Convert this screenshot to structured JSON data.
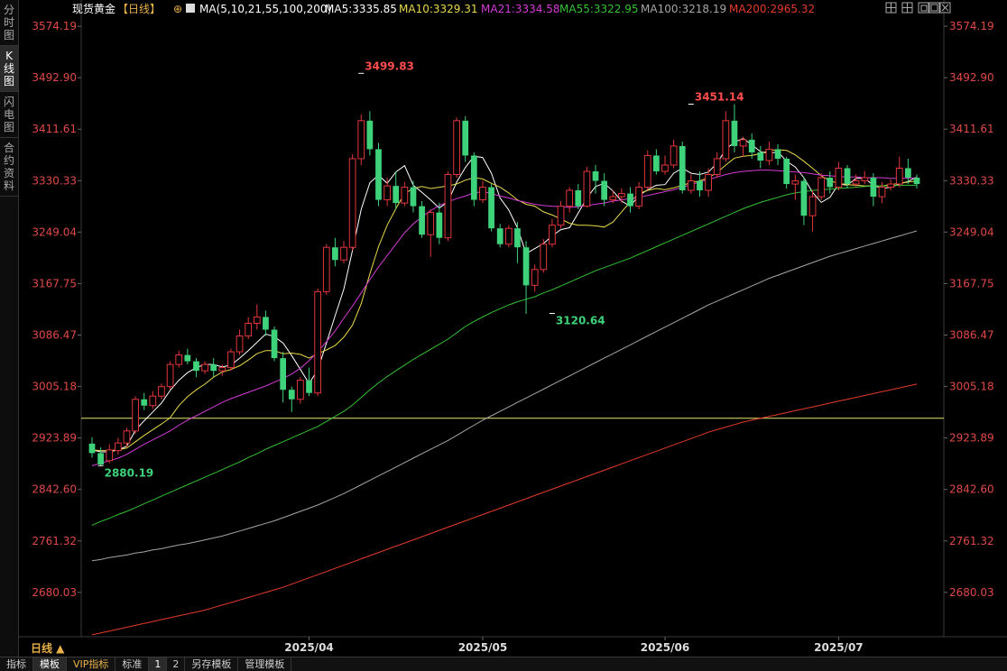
{
  "sidebar": {
    "tabs": [
      {
        "label": "分\n时\n图",
        "active": false
      },
      {
        "label": "K\n线\n图",
        "active": true
      },
      {
        "label": "闪\n电\n图",
        "active": false
      },
      {
        "label": "合\n约\n资\n料",
        "active": false
      }
    ]
  },
  "header": {
    "instrument": "现货黄金",
    "period": "【日线】",
    "ma_params": "MA(5,10,21,55,100,200)",
    "ma5": "MA5:3335.85",
    "ma10": "MA10:3329.31",
    "ma21": "MA21:3334.58",
    "ma55": "MA55:3322.95",
    "ma100": "MA100:3218.19",
    "ma200": "MA200:2965.32",
    "toolbar_icons": [
      "crosshair-icon",
      "grid-icon",
      "restore-icon",
      "maximize-icon",
      "close-icon"
    ]
  },
  "bottom": {
    "period_label": "日线 ▲",
    "items": [
      "指标",
      "模板",
      "VIP指标",
      "标准",
      "1",
      "2",
      "另存模板",
      "管理模板"
    ],
    "active_item": "模板"
  },
  "colors": {
    "up": "#e2363c",
    "down": "#3ed27b",
    "ma5": "#ffffff",
    "ma10": "#e8d94a",
    "ma21": "#d43bd6",
    "ma55": "#34c234",
    "ma100": "#a6a6a6",
    "ma200": "#e53a2b",
    "hline": "#e8e86a",
    "axis_text": "#e04848"
  },
  "chart_data": {
    "type": "candlestick",
    "y_ticks": [
      "3574.19",
      "3492.90",
      "3411.61",
      "3330.33",
      "3249.04",
      "3167.75",
      "3086.47",
      "3005.18",
      "2923.89",
      "2842.60",
      "2761.32",
      "2680.03"
    ],
    "ylim": [
      2610,
      3590
    ],
    "x_ticks": [
      {
        "label": "2025/04",
        "index": 25
      },
      {
        "label": "2025/05",
        "index": 45
      },
      {
        "label": "2025/06",
        "index": 66
      },
      {
        "label": "2025/07",
        "index": 86
      }
    ],
    "annotations": [
      {
        "label": "3499.83",
        "index": 31,
        "value": 3499.83,
        "side": "high",
        "color": "#ff4d4d"
      },
      {
        "label": "3451.14",
        "index": 69,
        "value": 3451.14,
        "side": "high",
        "color": "#ff4d4d"
      },
      {
        "label": "3120.64",
        "index": 53,
        "value": 3120.64,
        "side": "low",
        "color": "#3ed27b"
      },
      {
        "label": "2880.19",
        "index": 1,
        "value": 2880.19,
        "side": "low",
        "color": "#3ed27b"
      }
    ],
    "hline": 2955,
    "candles": [
      [
        2915,
        2900,
        2925,
        2893
      ],
      [
        2900,
        2882,
        2909,
        2880
      ],
      [
        2888,
        2905,
        2914,
        2884
      ],
      [
        2904,
        2916,
        2924,
        2898
      ],
      [
        2916,
        2935,
        2940,
        2910
      ],
      [
        2935,
        2985,
        2990,
        2930
      ],
      [
        2985,
        2975,
        2995,
        2968
      ],
      [
        2975,
        2990,
        2998,
        2970
      ],
      [
        2990,
        3005,
        3010,
        2985
      ],
      [
        3005,
        3040,
        3045,
        3000
      ],
      [
        3040,
        3055,
        3062,
        3035
      ],
      [
        3055,
        3045,
        3065,
        3040
      ],
      [
        3045,
        3030,
        3050,
        3020
      ],
      [
        3030,
        3040,
        3045,
        3025
      ],
      [
        3040,
        3030,
        3050,
        3020
      ],
      [
        3030,
        3035,
        3040,
        3022
      ],
      [
        3035,
        3060,
        3065,
        3030
      ],
      [
        3060,
        3085,
        3095,
        3055
      ],
      [
        3085,
        3105,
        3115,
        3080
      ],
      [
        3105,
        3115,
        3135,
        3095
      ],
      [
        3115,
        3095,
        3125,
        3085
      ],
      [
        3095,
        3050,
        3100,
        3045
      ],
      [
        3050,
        3000,
        3060,
        2980
      ],
      [
        3000,
        2985,
        3005,
        2965
      ],
      [
        2985,
        3015,
        3020,
        2978
      ],
      [
        3015,
        2995,
        3035,
        2990
      ],
      [
        2995,
        3155,
        3160,
        2990
      ],
      [
        3155,
        3225,
        3230,
        3150
      ],
      [
        3225,
        3205,
        3240,
        3195
      ],
      [
        3205,
        3225,
        3235,
        3200
      ],
      [
        3225,
        3365,
        3372,
        3220
      ],
      [
        3365,
        3425,
        3435,
        3355
      ],
      [
        3425,
        3380,
        3440,
        3370
      ],
      [
        3380,
        3300,
        3390,
        3290
      ],
      [
        3300,
        3322,
        3335,
        3290
      ],
      [
        3322,
        3295,
        3345,
        3285
      ],
      [
        3295,
        3320,
        3328,
        3290
      ],
      [
        3320,
        3290,
        3330,
        3280
      ],
      [
        3290,
        3245,
        3298,
        3240
      ],
      [
        3245,
        3280,
        3285,
        3210
      ],
      [
        3280,
        3240,
        3295,
        3230
      ],
      [
        3240,
        3340,
        3345,
        3235
      ],
      [
        3340,
        3425,
        3430,
        3335
      ],
      [
        3425,
        3370,
        3432,
        3360
      ],
      [
        3370,
        3300,
        3375,
        3290
      ],
      [
        3300,
        3320,
        3330,
        3295
      ],
      [
        3320,
        3255,
        3325,
        3250
      ],
      [
        3255,
        3230,
        3262,
        3225
      ],
      [
        3230,
        3255,
        3260,
        3225
      ],
      [
        3255,
        3225,
        3265,
        3200
      ],
      [
        3225,
        3165,
        3235,
        3120
      ],
      [
        3165,
        3190,
        3198,
        3155
      ],
      [
        3190,
        3230,
        3238,
        3185
      ],
      [
        3230,
        3260,
        3270,
        3225
      ],
      [
        3260,
        3290,
        3298,
        3255
      ],
      [
        3290,
        3315,
        3320,
        3280
      ],
      [
        3315,
        3290,
        3325,
        3285
      ],
      [
        3290,
        3345,
        3352,
        3288
      ],
      [
        3345,
        3330,
        3355,
        3310
      ],
      [
        3330,
        3300,
        3342,
        3290
      ],
      [
        3300,
        3305,
        3315,
        3295
      ],
      [
        3305,
        3310,
        3318,
        3295
      ],
      [
        3310,
        3290,
        3320,
        3280
      ],
      [
        3290,
        3320,
        3328,
        3285
      ],
      [
        3320,
        3370,
        3378,
        3315
      ],
      [
        3370,
        3345,
        3380,
        3340
      ],
      [
        3345,
        3355,
        3370,
        3340
      ],
      [
        3355,
        3385,
        3395,
        3350
      ],
      [
        3385,
        3315,
        3392,
        3310
      ],
      [
        3315,
        3330,
        3340,
        3310
      ],
      [
        3330,
        3315,
        3345,
        3305
      ],
      [
        3315,
        3340,
        3350,
        3305
      ],
      [
        3340,
        3365,
        3375,
        3335
      ],
      [
        3365,
        3425,
        3440,
        3360
      ],
      [
        3425,
        3385,
        3451,
        3375
      ],
      [
        3385,
        3395,
        3400,
        3368
      ],
      [
        3395,
        3375,
        3405,
        3365
      ],
      [
        3375,
        3362,
        3385,
        3350
      ],
      [
        3362,
        3380,
        3392,
        3355
      ],
      [
        3380,
        3365,
        3388,
        3355
      ],
      [
        3365,
        3325,
        3368,
        3318
      ],
      [
        3325,
        3330,
        3340,
        3300
      ],
      [
        3330,
        3275,
        3336,
        3260
      ],
      [
        3275,
        3305,
        3315,
        3250
      ],
      [
        3305,
        3335,
        3342,
        3300
      ],
      [
        3335,
        3320,
        3345,
        3310
      ],
      [
        3320,
        3350,
        3360,
        3315
      ],
      [
        3350,
        3325,
        3355,
        3318
      ],
      [
        3325,
        3330,
        3340,
        3320
      ],
      [
        3330,
        3335,
        3345,
        3325
      ],
      [
        3335,
        3305,
        3342,
        3290
      ],
      [
        3305,
        3320,
        3328,
        3295
      ],
      [
        3320,
        3325,
        3332,
        3315
      ],
      [
        3325,
        3350,
        3368,
        3320
      ],
      [
        3350,
        3335,
        3365,
        3325
      ],
      [
        3335,
        3325,
        3340,
        3318
      ]
    ],
    "series": [
      {
        "name": "MA5",
        "color": "#ffffff",
        "values": [
          2905,
          2902,
          2902,
          2905,
          2911,
          2936,
          2951,
          2965,
          2979,
          2999,
          3015,
          3027,
          3035,
          3040,
          3040,
          3036,
          3039,
          3050,
          3062,
          3075,
          3088,
          3084,
          3074,
          3054,
          3032,
          3010,
          3031,
          3074,
          3117,
          3159,
          3220,
          3285,
          3327,
          3339,
          3326,
          3344,
          3354,
          3323,
          3312,
          3300,
          3287,
          3297,
          3328,
          3351,
          3369,
          3367,
          3342,
          3303,
          3284,
          3256,
          3215,
          3223,
          3231,
          3243,
          3253,
          3256,
          3279,
          3303,
          3321,
          3326,
          3314,
          3298,
          3290,
          3307,
          3316,
          3323,
          3324,
          3342,
          3350,
          3342,
          3340,
          3344,
          3358,
          3380,
          3391,
          3397,
          3387,
          3376,
          3373,
          3376,
          3361,
          3352,
          3335,
          3312,
          3296,
          3304,
          3325,
          3323,
          3334,
          3334,
          3323,
          3318,
          3320,
          3325,
          3329,
          3336
        ]
      },
      {
        "name": "MA10",
        "color": "#e8d94a",
        "values": [
          2905,
          2904,
          2904,
          2905,
          2908,
          2918,
          2928,
          2937,
          2946,
          2956,
          2975,
          2989,
          3000,
          3009,
          3020,
          3028,
          3032,
          3038,
          3047,
          3057,
          3062,
          3062,
          3057,
          3058,
          3056,
          3050,
          3057,
          3063,
          3070,
          3083,
          3102,
          3136,
          3183,
          3226,
          3260,
          3286,
          3310,
          3318,
          3321,
          3318,
          3320,
          3322,
          3325,
          3331,
          3335,
          3333,
          3326,
          3320,
          3311,
          3300,
          3293,
          3290,
          3281,
          3276,
          3270,
          3263,
          3260,
          3260,
          3259,
          3257,
          3265,
          3281,
          3297,
          3310,
          3315,
          3318,
          3316,
          3319,
          3323,
          3327,
          3330,
          3335,
          3343,
          3355,
          3366,
          3369,
          3370,
          3373,
          3378,
          3379,
          3378,
          3371,
          3361,
          3350,
          3338,
          3330,
          3326,
          3324,
          3323,
          3322,
          3322,
          3322,
          3324,
          3326,
          3328,
          3330
        ]
      },
      {
        "name": "MA21",
        "color": "#d43bd6",
        "values": [
          2880,
          2884,
          2888,
          2892,
          2898,
          2906,
          2914,
          2921,
          2928,
          2935,
          2944,
          2952,
          2959,
          2966,
          2973,
          2980,
          2986,
          2991,
          2996,
          3001,
          3006,
          3012,
          3018,
          3025,
          3034,
          3046,
          3060,
          3076,
          3093,
          3113,
          3132,
          3153,
          3174,
          3194,
          3212,
          3230,
          3248,
          3262,
          3273,
          3283,
          3291,
          3297,
          3302,
          3306,
          3311,
          3313,
          3310,
          3306,
          3303,
          3299,
          3296,
          3293,
          3291,
          3290,
          3289,
          3288,
          3289,
          3291,
          3293,
          3295,
          3298,
          3300,
          3302,
          3304,
          3307,
          3310,
          3313,
          3316,
          3320,
          3324,
          3328,
          3332,
          3336,
          3340,
          3343,
          3345,
          3346,
          3347,
          3347,
          3346,
          3345,
          3344,
          3343,
          3341,
          3339,
          3338,
          3337,
          3336,
          3336,
          3335,
          3335,
          3335,
          3334,
          3334,
          3334,
          3335
        ]
      },
      {
        "name": "MA55",
        "color": "#34c234",
        "values": [
          2786,
          2792,
          2797,
          2803,
          2808,
          2814,
          2820,
          2826,
          2832,
          2838,
          2844,
          2850,
          2856,
          2862,
          2868,
          2874,
          2880,
          2886,
          2893,
          2899,
          2906,
          2912,
          2918,
          2924,
          2930,
          2936,
          2942,
          2950,
          2958,
          2966,
          2976,
          2988,
          3000,
          3011,
          3021,
          3030,
          3039,
          3048,
          3056,
          3064,
          3072,
          3080,
          3090,
          3100,
          3108,
          3115,
          3122,
          3128,
          3134,
          3139,
          3143,
          3147,
          3153,
          3158,
          3164,
          3170,
          3176,
          3182,
          3188,
          3193,
          3198,
          3203,
          3208,
          3214,
          3220,
          3226,
          3232,
          3238,
          3244,
          3250,
          3256,
          3262,
          3268,
          3274,
          3280,
          3286,
          3291,
          3296,
          3300,
          3304,
          3308,
          3311,
          3313,
          3315,
          3316,
          3317,
          3318,
          3319,
          3320,
          3321,
          3322,
          3322,
          3322,
          3323,
          3323,
          3323
        ]
      },
      {
        "name": "MA100",
        "color": "#a6a6a6",
        "values": [
          2730,
          2732,
          2735,
          2737,
          2739,
          2742,
          2744,
          2747,
          2749,
          2752,
          2755,
          2757,
          2760,
          2763,
          2766,
          2769,
          2773,
          2777,
          2781,
          2785,
          2789,
          2793,
          2798,
          2803,
          2808,
          2813,
          2818,
          2824,
          2830,
          2836,
          2843,
          2850,
          2857,
          2864,
          2871,
          2878,
          2885,
          2892,
          2899,
          2906,
          2913,
          2920,
          2928,
          2936,
          2944,
          2952,
          2959,
          2966,
          2973,
          2980,
          2987,
          2994,
          3001,
          3008,
          3015,
          3022,
          3029,
          3036,
          3043,
          3050,
          3057,
          3064,
          3071,
          3078,
          3085,
          3092,
          3099,
          3106,
          3113,
          3120,
          3127,
          3134,
          3140,
          3146,
          3152,
          3158,
          3164,
          3170,
          3176,
          3181,
          3186,
          3191,
          3196,
          3201,
          3206,
          3211,
          3215,
          3219,
          3223,
          3227,
          3231,
          3235,
          3239,
          3243,
          3247,
          3251
        ]
      },
      {
        "name": "MA200",
        "color": "#e53a2b",
        "values": [
          2613,
          2616,
          2619,
          2622,
          2625,
          2628,
          2631,
          2634,
          2637,
          2640,
          2643,
          2646,
          2649,
          2652,
          2656,
          2660,
          2664,
          2668,
          2672,
          2676,
          2680,
          2684,
          2688,
          2693,
          2698,
          2703,
          2708,
          2713,
          2718,
          2723,
          2728,
          2733,
          2738,
          2743,
          2748,
          2753,
          2758,
          2763,
          2768,
          2773,
          2778,
          2783,
          2788,
          2793,
          2798,
          2803,
          2808,
          2813,
          2818,
          2823,
          2828,
          2833,
          2838,
          2843,
          2848,
          2853,
          2858,
          2863,
          2868,
          2873,
          2878,
          2883,
          2888,
          2893,
          2898,
          2903,
          2908,
          2913,
          2918,
          2923,
          2928,
          2933,
          2937,
          2941,
          2945,
          2949,
          2952,
          2955,
          2958,
          2961,
          2964,
          2967,
          2970,
          2973,
          2976,
          2979,
          2982,
          2985,
          2988,
          2991,
          2994,
          2997,
          3000,
          3003,
          3006,
          3009
        ]
      }
    ]
  }
}
